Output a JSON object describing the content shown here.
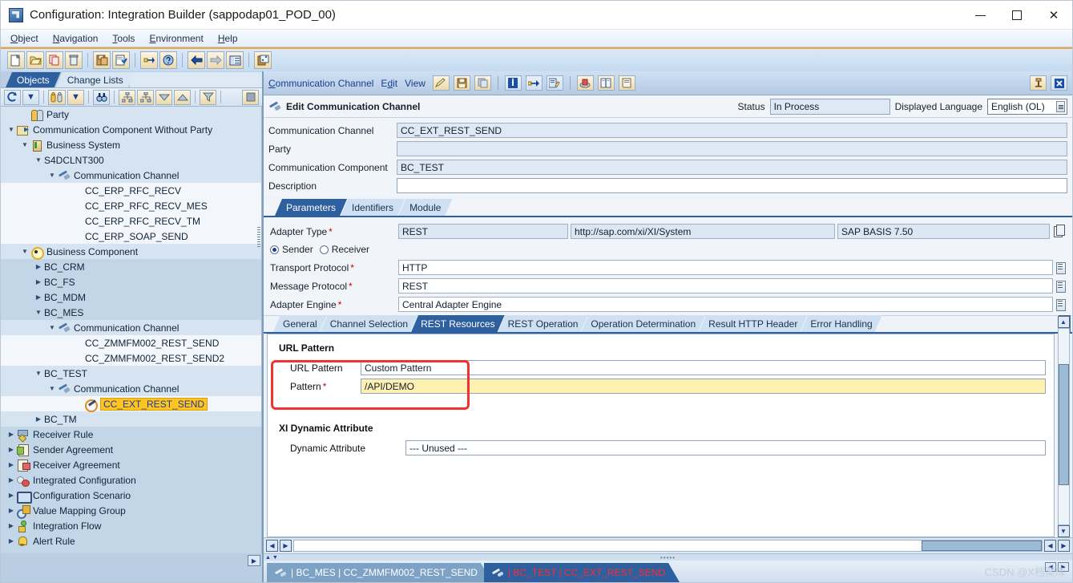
{
  "window": {
    "title": "Configuration: Integration Builder (sappodap01_POD_00)",
    "icon": "app-window-icon",
    "minimize": "—",
    "maximize": "□",
    "close": "✕"
  },
  "menubar": {
    "items": [
      {
        "label": "Object",
        "accel": "O"
      },
      {
        "label": "Navigation",
        "accel": "N"
      },
      {
        "label": "Tools",
        "accel": "T"
      },
      {
        "label": "Environment",
        "accel": "E"
      },
      {
        "label": "Help",
        "accel": "H"
      }
    ]
  },
  "main_toolbar": {
    "buttons": [
      {
        "name": "new-icon",
        "glyph": "ᵈ"
      },
      {
        "name": "open-folder-icon",
        "glyph": "ᵈ"
      },
      {
        "name": "copy-icon",
        "glyph": "ᵈ"
      },
      {
        "name": "delete-trash-icon",
        "glyph": "ᵈ"
      },
      {
        "name": "save-all-icon",
        "glyph": "ᵈ"
      },
      {
        "name": "check-document-icon",
        "glyph": "ᵈ"
      },
      {
        "name": "where-used-icon",
        "glyph": "ᵈ"
      },
      {
        "name": "help-globe-icon",
        "glyph": "ᵈ"
      },
      {
        "name": "back-arrow-icon",
        "glyph": "ᵈ"
      },
      {
        "name": "forward-arrow-icon",
        "glyph": "ᵈ"
      },
      {
        "name": "list-view-icon",
        "glyph": "ᵈ"
      },
      {
        "name": "settings-card-icon",
        "glyph": "ᵈ"
      }
    ]
  },
  "left_pane": {
    "tabs": [
      {
        "label": "Objects",
        "active": true
      },
      {
        "label": "Change Lists",
        "active": false
      }
    ],
    "toolbar": [
      {
        "name": "refresh-icon"
      },
      {
        "name": "refresh-dropdown-icon"
      },
      {
        "name": "party-filter-icon"
      },
      {
        "name": "party-filter-dropdown-icon"
      },
      {
        "name": "find-binoculars-icon"
      },
      {
        "name": "expand-all-icon"
      },
      {
        "name": "collapse-all-icon"
      },
      {
        "name": "expand-down-icon"
      },
      {
        "name": "collapse-up-icon"
      },
      {
        "name": "filter-icon"
      },
      {
        "name": "stop-square-icon"
      }
    ],
    "tree": [
      {
        "label": "Party",
        "indent": 1,
        "twist": "",
        "icon": "ic-party",
        "band": "shade"
      },
      {
        "label": "Communication Component Without Party",
        "indent": 0,
        "twist": "down",
        "icon": "ic-comp",
        "band": "shade"
      },
      {
        "label": "Business System",
        "indent": 1,
        "twist": "down",
        "icon": "ic-bs",
        "band": "shade"
      },
      {
        "label": "S4DCLNT300",
        "indent": 2,
        "twist": "down",
        "icon": "",
        "band": "shade"
      },
      {
        "label": "Communication Channel",
        "indent": 3,
        "twist": "down",
        "icon": "ic-cc",
        "band": "shade"
      },
      {
        "label": "CC_ERP_RFC_RECV",
        "indent": 5,
        "twist": "",
        "icon": "",
        "band": "white"
      },
      {
        "label": "CC_ERP_RFC_RECV_MES",
        "indent": 5,
        "twist": "",
        "icon": "",
        "band": "white"
      },
      {
        "label": "CC_ERP_RFC_RECV_TM",
        "indent": 5,
        "twist": "",
        "icon": "",
        "band": "white"
      },
      {
        "label": "CC_ERP_SOAP_SEND",
        "indent": 5,
        "twist": "",
        "icon": "",
        "band": "white"
      },
      {
        "label": "Business Component",
        "indent": 1,
        "twist": "down",
        "icon": "ic-bc",
        "band": "shade"
      },
      {
        "label": "BC_CRM",
        "indent": 2,
        "twist": "right",
        "icon": "",
        "band": "plain"
      },
      {
        "label": "BC_FS",
        "indent": 2,
        "twist": "right",
        "icon": "",
        "band": "plain"
      },
      {
        "label": "BC_MDM",
        "indent": 2,
        "twist": "right",
        "icon": "",
        "band": "plain"
      },
      {
        "label": "BC_MES",
        "indent": 2,
        "twist": "down",
        "icon": "",
        "band": "plain"
      },
      {
        "label": "Communication Channel",
        "indent": 3,
        "twist": "down",
        "icon": "ic-cc",
        "band": "shade"
      },
      {
        "label": "CC_ZMMFM002_REST_SEND",
        "indent": 5,
        "twist": "",
        "icon": "",
        "band": "white"
      },
      {
        "label": "CC_ZMMFM002_REST_SEND2",
        "indent": 5,
        "twist": "",
        "icon": "",
        "band": "white"
      },
      {
        "label": "BC_TEST",
        "indent": 2,
        "twist": "down",
        "icon": "",
        "band": "shade"
      },
      {
        "label": "Communication Channel",
        "indent": 3,
        "twist": "down",
        "icon": "ic-cc",
        "band": "shade"
      },
      {
        "label": "CC_EXT_REST_SEND",
        "indent": 5,
        "twist": "",
        "icon": "ic-pencil",
        "band": "white",
        "selected": true
      },
      {
        "label": "BC_TM",
        "indent": 2,
        "twist": "right",
        "icon": "",
        "band": "shade"
      },
      {
        "label": "Receiver Rule",
        "indent": 0,
        "twist": "right",
        "icon": "ic-rr",
        "band": "plain"
      },
      {
        "label": "Sender Agreement",
        "indent": 0,
        "twist": "right",
        "icon": "ic-sa",
        "band": "plain"
      },
      {
        "label": "Receiver Agreement",
        "indent": 0,
        "twist": "right",
        "icon": "ic-ra",
        "band": "plain"
      },
      {
        "label": "Integrated Configuration",
        "indent": 0,
        "twist": "right",
        "icon": "ic-ig",
        "band": "plain"
      },
      {
        "label": "Configuration Scenario",
        "indent": 0,
        "twist": "right",
        "icon": "ic-cs",
        "band": "plain"
      },
      {
        "label": "Value Mapping Group",
        "indent": 0,
        "twist": "right",
        "icon": "ic-vm",
        "band": "plain"
      },
      {
        "label": "Integration Flow",
        "indent": 0,
        "twist": "right",
        "icon": "ic-if",
        "band": "plain"
      },
      {
        "label": "Alert Rule",
        "indent": 0,
        "twist": "right",
        "icon": "ic-ar",
        "band": "plain"
      }
    ]
  },
  "inner_window": {
    "menu": [
      {
        "label": "Communication Channel",
        "accel": "C"
      },
      {
        "label": "Edit",
        "accel": "d"
      },
      {
        "label": "View",
        "accel": ""
      }
    ],
    "toolbar": [
      {
        "name": "edit-pencil-icon"
      },
      {
        "name": "save-icon"
      },
      {
        "name": "copy-icon"
      },
      {
        "name": "info-icon"
      },
      {
        "name": "where-used-icon"
      },
      {
        "name": "change-list-icon"
      },
      {
        "name": "cache-notification-icon"
      },
      {
        "name": "documentation-icon"
      },
      {
        "name": "history-scroll-icon"
      }
    ],
    "right_buttons": [
      {
        "name": "pin-icon"
      },
      {
        "name": "close-window-icon"
      }
    ],
    "panel_title": "Edit Communication Channel",
    "status_label": "Status",
    "status_value": "In Process",
    "language_label": "Displayed Language",
    "language_value": "English (OL)",
    "fields": [
      {
        "label": "Communication Channel",
        "value": "CC_EXT_REST_SEND",
        "readonly": true
      },
      {
        "label": "Party",
        "value": "",
        "readonly": true
      },
      {
        "label": "Communication Component",
        "value": "BC_TEST",
        "readonly": true
      },
      {
        "label": "Description",
        "value": "",
        "readonly": false
      }
    ],
    "tabs": [
      {
        "label": "Parameters",
        "active": true
      },
      {
        "label": "Identifiers",
        "active": false
      },
      {
        "label": "Module",
        "active": false
      }
    ],
    "parameters": {
      "adapter_type_label": "Adapter Type",
      "adapter_type_value": "REST",
      "adapter_namespace": "http://sap.com/xi/XI/System",
      "adapter_swcv": "SAP BASIS 7.50",
      "direction": {
        "sender_label": "Sender",
        "receiver_label": "Receiver",
        "selected": "Sender"
      },
      "rows": [
        {
          "label": "Transport Protocol",
          "value": "HTTP",
          "required": true
        },
        {
          "label": "Message Protocol",
          "value": "REST",
          "required": true
        },
        {
          "label": "Adapter Engine",
          "value": "Central Adapter Engine",
          "required": true
        }
      ]
    },
    "subtabs": [
      {
        "label": "General",
        "active": false
      },
      {
        "label": "Channel Selection",
        "active": false
      },
      {
        "label": "REST Resources",
        "active": true
      },
      {
        "label": "REST Operation",
        "active": false
      },
      {
        "label": "Operation Determination",
        "active": false
      },
      {
        "label": "Result HTTP Header",
        "active": false
      },
      {
        "label": "Error Handling",
        "active": false
      }
    ],
    "rest_resources": {
      "url_pattern_section": "URL Pattern",
      "url_pattern_label": "URL Pattern",
      "url_pattern_value": "Custom Pattern",
      "pattern_label": "Pattern",
      "pattern_value": "/API/DEMO",
      "pattern_required": true,
      "dynamic_section": "XI Dynamic Attribute",
      "dynamic_label": "Dynamic Attribute",
      "dynamic_value": "--- Unused ---",
      "highlight_color": "#f0332f"
    }
  },
  "document_tabs": [
    {
      "prefix": "|",
      "component": "BC_MES",
      "sep": "|",
      "channel": "CC_ZMMFM002_REST_SEND",
      "active": false,
      "text": "| BC_MES | CC_ZMMFM002_REST_SEND"
    },
    {
      "prefix": "|",
      "component": "BC_TEST",
      "sep": "|",
      "channel": "CC_EXT_REST_SEND",
      "active": true,
      "text": "| BC_TEST | CC_EXT_REST_SEND"
    }
  ],
  "watermark": "CSDN @X档案库",
  "colors": {
    "accent_blue": "#2e5f9e",
    "tab_inactive": "#cfe0f2",
    "field_readonly": "#dce7f4",
    "required_yellow": "#fdf0b0",
    "highlight_red": "#f0332f",
    "selection_orange": "#ffc423",
    "toolbar_gold": "#e8a33d"
  }
}
